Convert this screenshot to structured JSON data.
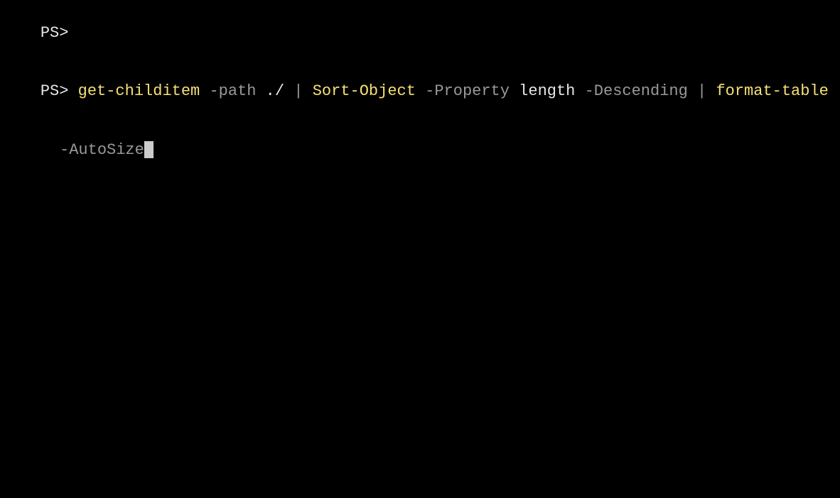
{
  "lines": [
    {
      "prompt": "PS>",
      "segments": []
    },
    {
      "prompt": "PS>",
      "segments": [
        {
          "text": " ",
          "type": "plain"
        },
        {
          "text": "get-childitem",
          "type": "cmdlet"
        },
        {
          "text": " ",
          "type": "plain"
        },
        {
          "text": "-path",
          "type": "param"
        },
        {
          "text": " ./ ",
          "type": "plain"
        },
        {
          "text": "|",
          "type": "pipe"
        },
        {
          "text": " ",
          "type": "plain"
        },
        {
          "text": "Sort-Object",
          "type": "cmdlet"
        },
        {
          "text": " ",
          "type": "plain"
        },
        {
          "text": "-Property",
          "type": "param"
        },
        {
          "text": " length ",
          "type": "plain"
        },
        {
          "text": "-Descending",
          "type": "param"
        },
        {
          "text": " ",
          "type": "plain"
        },
        {
          "text": "|",
          "type": "pipe"
        },
        {
          "text": " ",
          "type": "plain"
        },
        {
          "text": "format-table",
          "type": "cmdlet"
        }
      ]
    }
  ],
  "wrapLine": {
    "segments": [
      {
        "text": " ",
        "type": "plain"
      },
      {
        "text": "-AutoSize",
        "type": "param"
      }
    ]
  }
}
